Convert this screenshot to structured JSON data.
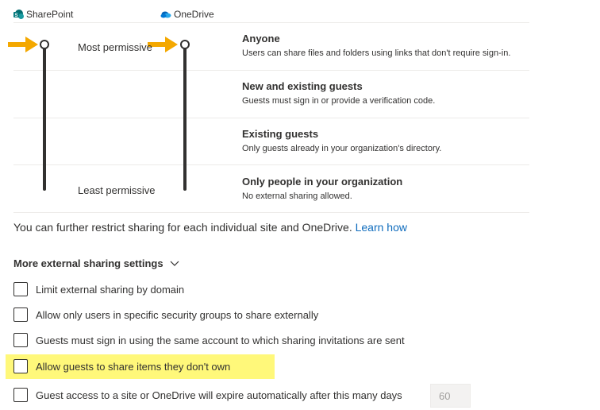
{
  "header": {
    "sharepoint_label": "SharePoint",
    "onedrive_label": "OneDrive",
    "sharepoint_logo_color": "#036c70",
    "onedrive_logo_color": "#0f78d4"
  },
  "slider": {
    "most_label": "Most permissive",
    "least_label": "Least permissive",
    "sharepoint_level": "Anyone",
    "onedrive_level": "Anyone"
  },
  "levels": [
    {
      "title": "Anyone",
      "desc": "Users can share files and folders using links that don't require sign-in."
    },
    {
      "title": "New and existing guests",
      "desc": "Guests must sign in or provide a verification code."
    },
    {
      "title": "Existing guests",
      "desc": "Only guests already in your organization's directory."
    },
    {
      "title": "Only people in your organization",
      "desc": "No external sharing allowed."
    }
  ],
  "restrict_note": {
    "text": "You can further restrict sharing for each individual site and OneDrive. ",
    "link": "Learn how"
  },
  "more_settings": {
    "label": "More external sharing settings",
    "icon": "chevron-down-icon"
  },
  "checkboxes": [
    {
      "label": "Limit external sharing by domain",
      "checked": false
    },
    {
      "label": "Allow only users in specific security groups to share externally",
      "checked": false
    },
    {
      "label": "Guests must sign in using the same account to which sharing invitations are sent",
      "checked": false
    },
    {
      "label": "Allow guests to share items they don't own",
      "checked": false
    },
    {
      "label": "Guest access to a site or OneDrive will expire automatically after this many days",
      "checked": false
    }
  ],
  "expire_days": {
    "value": "60"
  },
  "colors": {
    "arrow": "#f4a800",
    "highlight": "#fff64d",
    "link": "#0f6cbd"
  }
}
